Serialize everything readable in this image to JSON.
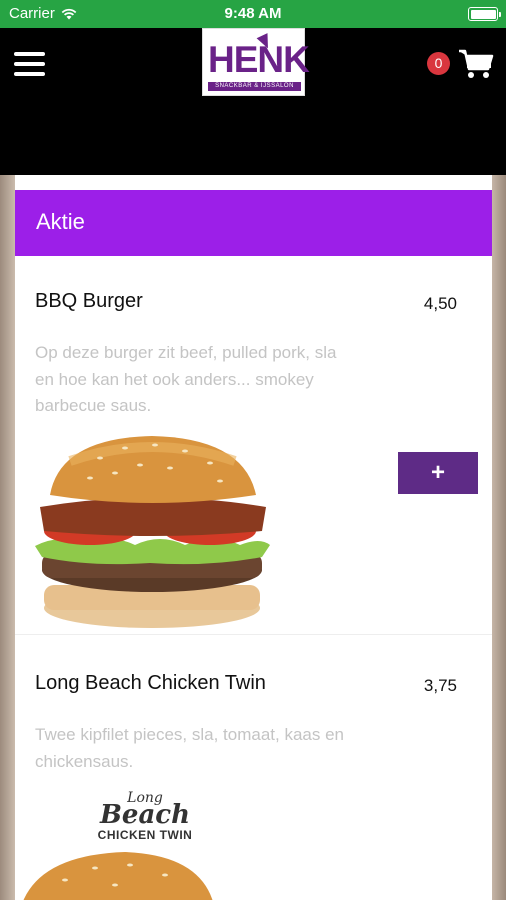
{
  "status_bar": {
    "carrier": "Carrier",
    "time": "9:48 AM"
  },
  "header": {
    "logo": {
      "name": "HENK",
      "tagline": "SNACKBAR & IJSSALON"
    },
    "cart_count": "0",
    "icons": {
      "menu": "hamburger-menu-icon",
      "cart": "shopping-cart-icon"
    }
  },
  "section": {
    "title": "Aktie"
  },
  "items": [
    {
      "name": "BBQ Burger",
      "price": "4,50",
      "description": "Op deze burger zit beef, pulled pork, sla en hoe kan het ook anders... smokey barbecue saus.",
      "add_label": "+"
    },
    {
      "name": "Long Beach Chicken Twin",
      "price": "3,75",
      "description": "Twee kipfilet pieces, sla, tomaat, kaas en chickensaus.",
      "image_logo": {
        "line1": "Long",
        "line2": "Beach",
        "line3": "CHICKEN TWIN"
      }
    }
  ],
  "colors": {
    "status_bar": "#27a444",
    "nav_bar": "#000000",
    "section_header": "#9c1fe8",
    "add_button": "#5e2b86",
    "badge": "#d9363e",
    "logo": "#6a2288"
  }
}
